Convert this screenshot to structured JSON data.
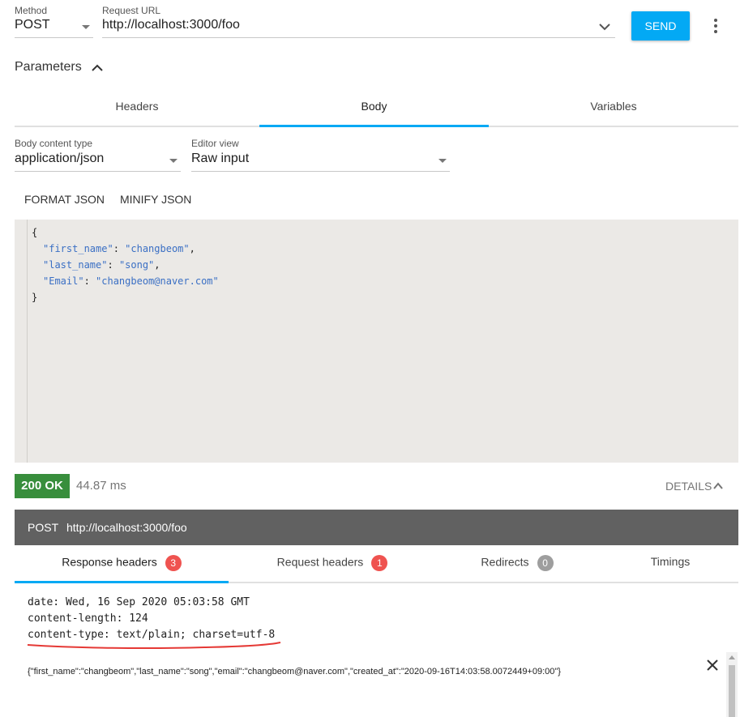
{
  "request": {
    "method_label": "Method",
    "method_value": "POST",
    "url_label": "Request URL",
    "url_value": "http://localhost:3000/foo",
    "send_label": "SEND"
  },
  "parameters": {
    "title": "Parameters",
    "tabs": [
      "Headers",
      "Body",
      "Variables"
    ],
    "active_tab": "Body"
  },
  "body_editor": {
    "content_type_label": "Body content type",
    "content_type_value": "application/json",
    "editor_view_label": "Editor view",
    "editor_view_value": "Raw input",
    "format_label": "FORMAT JSON",
    "minify_label": "MINIFY JSON",
    "lines": [
      {
        "text": "{"
      },
      {
        "key": "\"first_name\"",
        "value": "\"changbeom\"",
        "trail": ","
      },
      {
        "key": "\"last_name\"",
        "value": "\"song\"",
        "trail": ","
      },
      {
        "key": "\"Email\"",
        "value": "\"changbeom@naver.com\"",
        "trail": ""
      },
      {
        "text": "}"
      }
    ]
  },
  "response": {
    "status": "200 OK",
    "time": "44.87 ms",
    "details_label": "DETAILS",
    "summary_method": "POST",
    "summary_url": "http://localhost:3000/foo",
    "tabs": [
      {
        "label": "Response headers",
        "count": "3",
        "badge_color": "#ef5350"
      },
      {
        "label": "Request headers",
        "count": "1",
        "badge_color": "#ef5350"
      },
      {
        "label": "Redirects",
        "count": "0",
        "badge_color": "#9e9e9e"
      },
      {
        "label": "Timings",
        "count": "",
        "badge_color": ""
      }
    ],
    "headers": [
      "date: Wed, 16 Sep 2020 05:03:58 GMT",
      "content-length: 124",
      "content-type: text/plain; charset=utf-8"
    ],
    "body": "{\"first_name\":\"changbeom\",\"last_name\":\"song\",\"email\":\"changbeom@naver.com\",\"created_at\":\"2020-09-16T14:03:58.0072449+09:00\"}"
  },
  "colors": {
    "accent": "#03a9f4",
    "success": "#388e3c",
    "summary_bar": "#616161",
    "annotation": "#e53935"
  }
}
